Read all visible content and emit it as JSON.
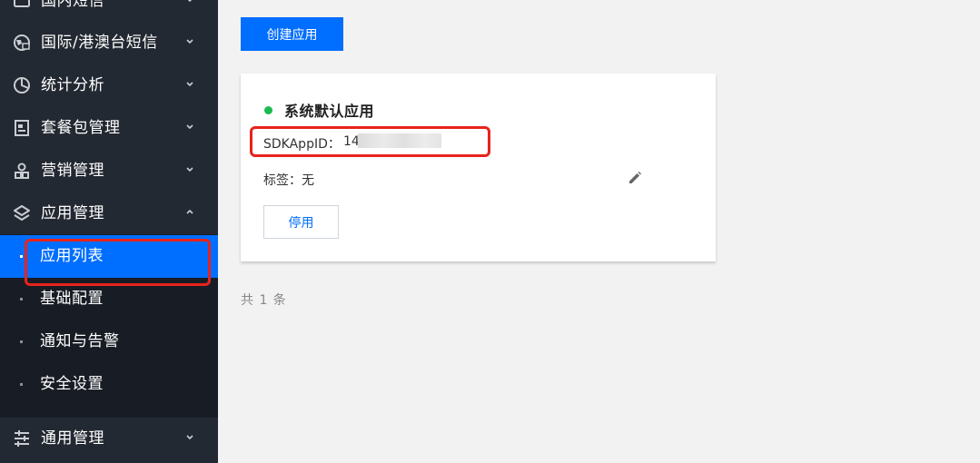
{
  "sidebar": {
    "items": [
      {
        "label": "国内短信",
        "icon": "message-icon",
        "expanded": false
      },
      {
        "label": "国际/港澳台短信",
        "icon": "globe-icon",
        "expanded": false
      },
      {
        "label": "统计分析",
        "icon": "pie-chart-icon",
        "expanded": false
      },
      {
        "label": "套餐包管理",
        "icon": "package-icon",
        "expanded": false
      },
      {
        "label": "营销管理",
        "icon": "user-group-icon",
        "expanded": false
      },
      {
        "label": "应用管理",
        "icon": "layers-icon",
        "expanded": true
      },
      {
        "label": "通用管理",
        "icon": "sliders-icon",
        "expanded": false
      }
    ],
    "sub_items": [
      {
        "label": "应用列表",
        "active": true
      },
      {
        "label": "基础配置",
        "active": false
      },
      {
        "label": "通知与告警",
        "active": false
      },
      {
        "label": "安全设置",
        "active": false
      }
    ]
  },
  "main": {
    "create_button": "创建应用",
    "card": {
      "status_color": "#1dba4f",
      "app_name": "系统默认应用",
      "appid_label": "SDKAppID：",
      "appid_value": "14",
      "tag_label": "标签：无",
      "disable_button": "停用"
    },
    "total_text": "共 1 条"
  },
  "colors": {
    "sidebar_bg": "#232932",
    "submenu_bg": "#181d25",
    "accent": "#006eff",
    "highlight_box": "#e8231c"
  }
}
